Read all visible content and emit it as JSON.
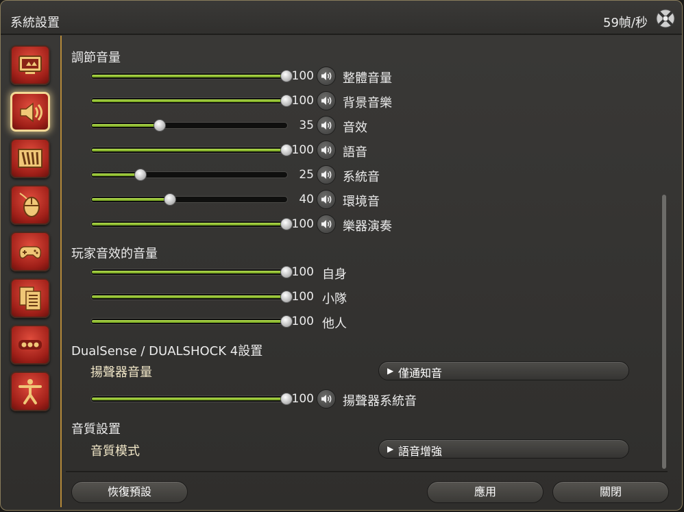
{
  "window": {
    "title": "系統設置",
    "fps": "59幀/秒"
  },
  "sidebar": {
    "items": [
      {
        "icon": "display-settings-icon",
        "active": false
      },
      {
        "icon": "speaker-icon",
        "active": true
      },
      {
        "icon": "hud-bars-icon",
        "active": false
      },
      {
        "icon": "mouse-icon",
        "active": false
      },
      {
        "icon": "gamepad-icon",
        "active": false
      },
      {
        "icon": "documents-icon",
        "active": false
      },
      {
        "icon": "more-options-icon",
        "active": false
      },
      {
        "icon": "accessibility-icon",
        "active": false
      }
    ]
  },
  "volume_section": {
    "title": "調節音量",
    "rows": [
      {
        "label": "整體音量",
        "value": "100",
        "level": 1.0
      },
      {
        "label": "背景音樂",
        "value": "100",
        "level": 1.0
      },
      {
        "label": "音效",
        "value": "35",
        "level": 0.35
      },
      {
        "label": "語音",
        "value": "100",
        "level": 1.0
      },
      {
        "label": "系統音",
        "value": "25",
        "level": 0.25
      },
      {
        "label": "環境音",
        "value": "40",
        "level": 0.4
      },
      {
        "label": "樂器演奏",
        "value": "100",
        "level": 1.0
      }
    ]
  },
  "player_section": {
    "title": "玩家音效的音量",
    "rows": [
      {
        "label": "自身",
        "value": "100",
        "level": 1.0
      },
      {
        "label": "小隊",
        "value": "100",
        "level": 1.0
      },
      {
        "label": "他人",
        "value": "100",
        "level": 1.0
      }
    ]
  },
  "controller_section": {
    "title": "DualSense / DUALSHOCK 4設置",
    "speaker_volume_label": "揚聲器音量",
    "speaker_volume_option": "僅通知音",
    "speaker_row": {
      "label": "揚聲器系統音",
      "value": "100",
      "level": 1.0
    }
  },
  "quality_section": {
    "title": "音質設置",
    "mode_label": "音質模式",
    "mode_option": "語音增強"
  },
  "footer": {
    "reset": "恢復預設",
    "apply": "應用",
    "close": "關閉"
  },
  "colors": {
    "slider_fill": "#a6d63a",
    "active_tab_border": "#f3d995",
    "tab_red": "#c43428"
  }
}
